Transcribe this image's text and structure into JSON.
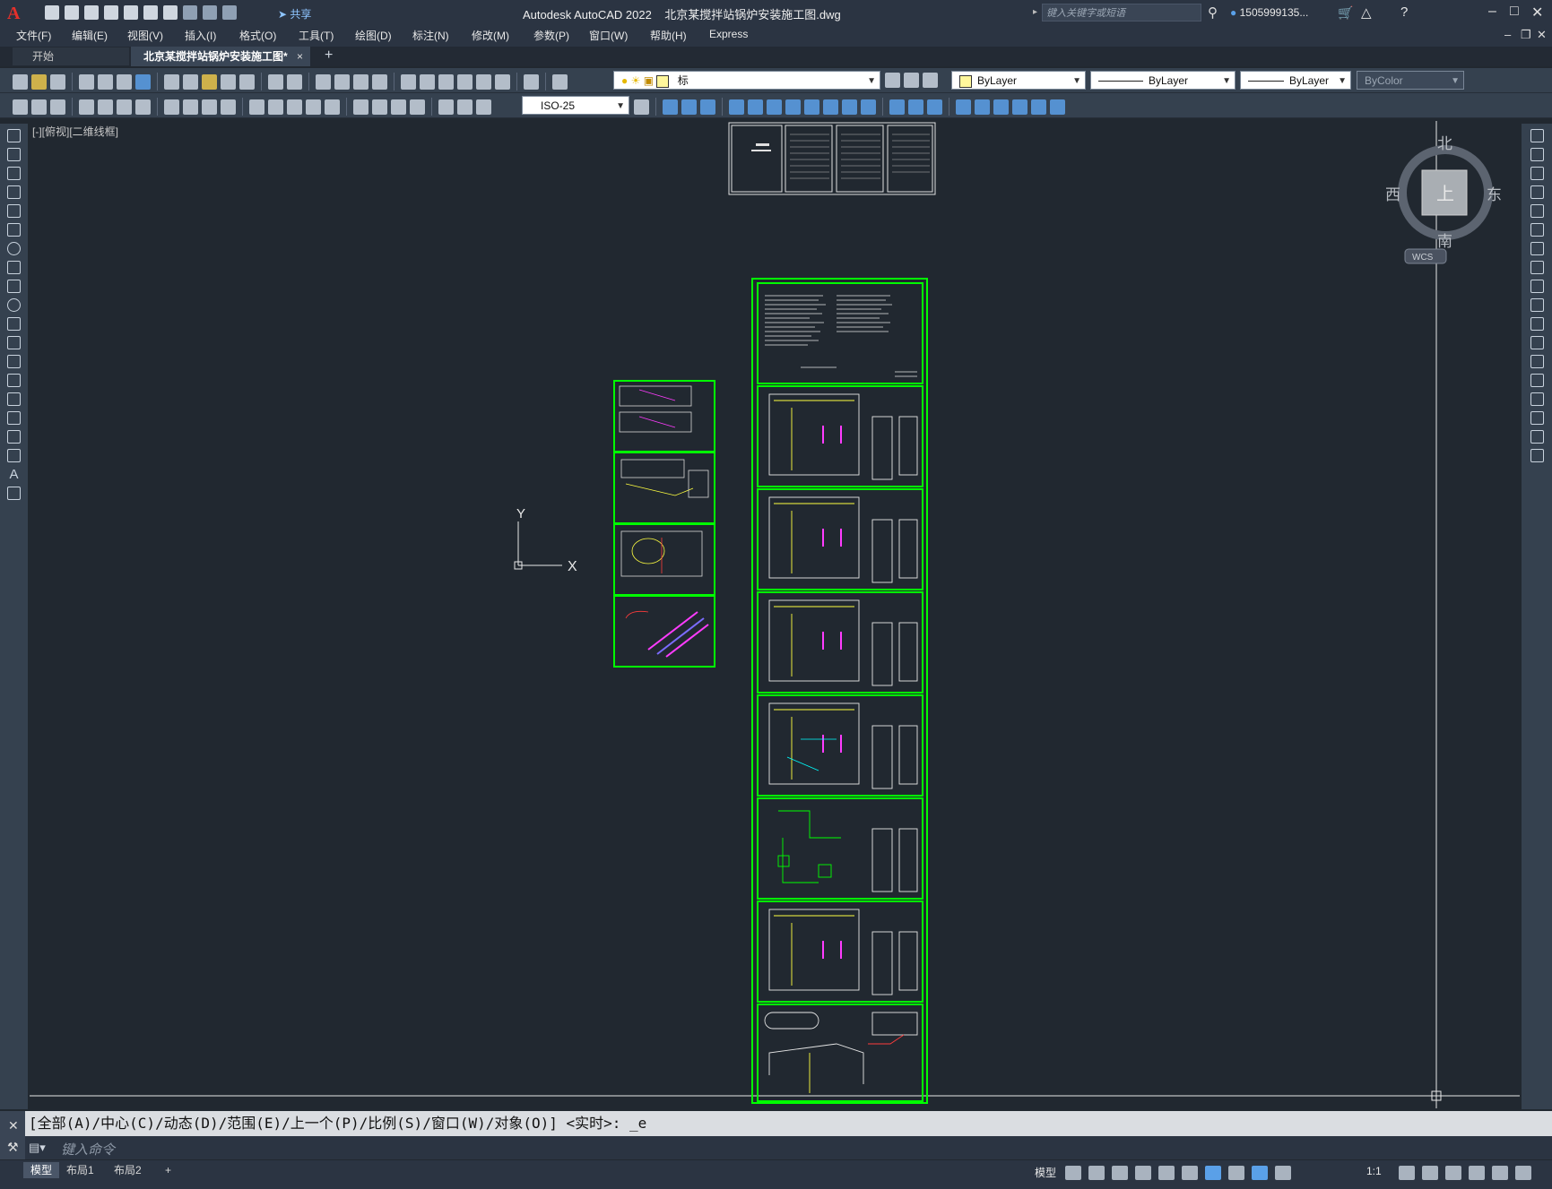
{
  "app": {
    "window_title": "Autodesk AutoCAD 2022    北京某搅拌站锅炉安装施工图.dwg",
    "logo_letter": "A",
    "share_label": "共享",
    "search_placeholder": "键入关键字或短语",
    "user_name": "1505999135..."
  },
  "menu": [
    "文件(F)",
    "编辑(E)",
    "视图(V)",
    "插入(I)",
    "格式(O)",
    "工具(T)",
    "绘图(D)",
    "标注(N)",
    "修改(M)",
    "参数(P)",
    "窗口(W)",
    "帮助(H)",
    "Express"
  ],
  "tabs": {
    "start": "开始",
    "doc": "北京某搅拌站锅炉安装施工图*",
    "close": "×",
    "add": "+"
  },
  "toolbar": {
    "layer_name": "标",
    "color": "ByLayer",
    "linetype": "ByLayer",
    "lineweight": "ByLayer",
    "plotstyle": "ByColor",
    "dimstyle": "ISO-25"
  },
  "viewport": {
    "label": "[-][俯视][二维线框]",
    "ucs_x": "X",
    "ucs_y": "Y"
  },
  "viewcube": {
    "north": "北",
    "south": "南",
    "east": "东",
    "west": "西",
    "top": "上",
    "wcs": "WCS"
  },
  "command": {
    "history": "[全部(A)/中心(C)/动态(D)/范围(E)/上一个(P)/比例(S)/窗口(W)/对象(O)] <实时>: _e",
    "placeholder": "键入命令"
  },
  "status": {
    "tabs": [
      "模型",
      "布局1",
      "布局2"
    ],
    "add": "+",
    "model_label": "模型",
    "scale": "1:1"
  },
  "colors": {
    "sheet_border": "#00ff00",
    "canvas_bg": "#212830",
    "accent": "#5aa0e8"
  }
}
